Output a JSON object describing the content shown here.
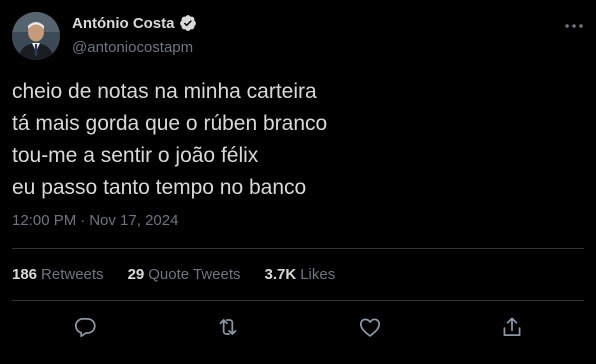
{
  "author": {
    "display_name": "António Costa",
    "handle": "@antoniocostapm",
    "verified": true,
    "avatar": "portrait-avatar"
  },
  "tweet": {
    "lines": [
      "cheio de notas na minha carteira",
      "tá mais gorda que o rúben branco",
      "tou-me a sentir o joão félix",
      "eu passo tanto tempo no banco"
    ],
    "time": "12:00 PM",
    "separator": "·",
    "date": "Nov 17, 2024"
  },
  "stats": {
    "retweets": {
      "count": "186",
      "label": "Retweets"
    },
    "quote_tweets": {
      "count": "29",
      "label": "Quote Tweets"
    },
    "likes": {
      "count": "3.7K",
      "label": "Likes"
    }
  },
  "actions": {
    "reply": "reply-icon",
    "retweet": "retweet-icon",
    "like": "heart-icon",
    "share": "share-icon",
    "more": "more-icon"
  },
  "colors": {
    "background": "#000000",
    "text_primary": "#d9d9d9",
    "text_secondary": "#6e767d",
    "divider": "#2f3336",
    "verified_badge": "#d9d9d9"
  }
}
